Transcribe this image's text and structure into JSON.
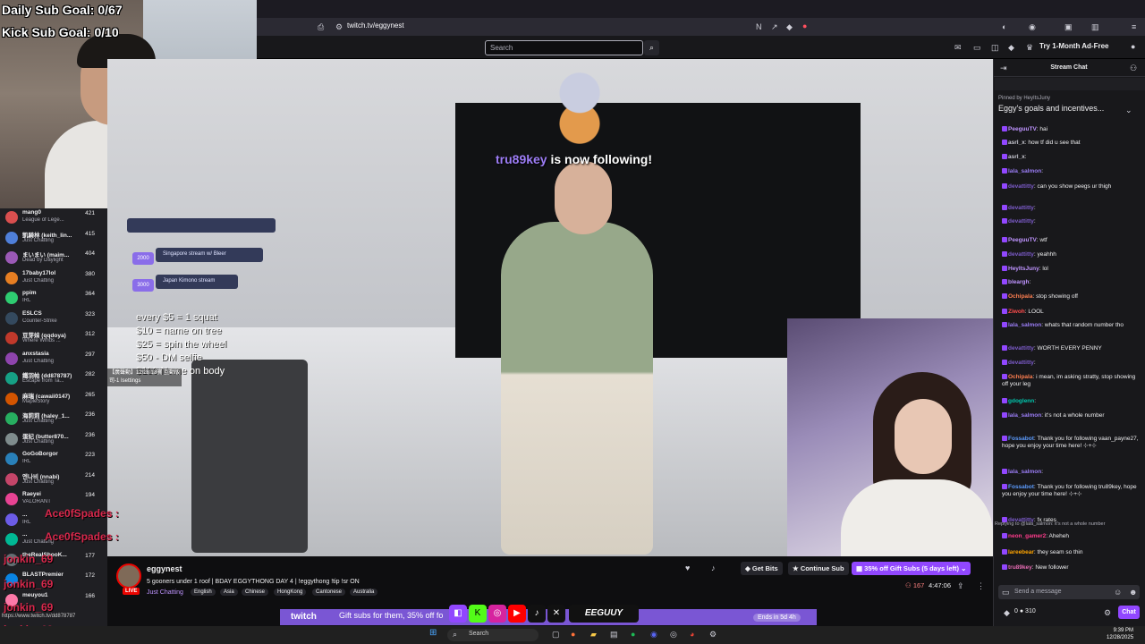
{
  "overlay": {
    "goal1": "Daily Sub Goal: 0/67",
    "goal2": "Kick Sub Goal: 0/10",
    "incentives": [
      "every $5 = 1 squat",
      "$10 = name on tree",
      "$25 = spin the wheel",
      "$50 - DM selfie",
      "$100 Name on body"
    ],
    "pill1_num": "2000",
    "pill1_text": "Singapore stream w/ Bleer",
    "pill2_num": "3000",
    "pill2_text": "Japan Kimono stream",
    "settings_line1": "【廣聲動】12/28 18寶 互動版",
    "settings_line2": "司-1 Isettings",
    "follow_name": "tru89key",
    "follow_text": "is now following!",
    "chat_overlay": [
      "Ace0fSpades :",
      "Ace0fSpades :",
      "jonkin_69",
      "jonkin_69",
      "jonkin_69",
      "jonkin_69"
    ]
  },
  "browser": {
    "url": "twitch.tv/eggynest",
    "search_placeholder": "Search",
    "ad_free": "Try 1-Month Ad-Free"
  },
  "sidebar": {
    "items": [
      {
        "name": "mang0",
        "category": "League of Lege...",
        "count": "421"
      },
      {
        "name": "凱騎林 (keith_lin...",
        "category": "Just Chatting",
        "count": "415"
      },
      {
        "name": "まいまい (maim...",
        "category": "Dead by Daylight",
        "count": "404"
      },
      {
        "name": "17baby17lol",
        "category": "Just Chatting",
        "count": "380"
      },
      {
        "name": "ppim",
        "category": "IRL",
        "count": "364"
      },
      {
        "name": "ESLCS",
        "category": "Counter-Strike",
        "count": "323"
      },
      {
        "name": "豆芽妹 (qqdoya)",
        "category": "Where Winds ...",
        "count": "312"
      },
      {
        "name": "anxstasia",
        "category": "Just Chatting",
        "count": "297"
      },
      {
        "name": "鐵羽帕 (dd878787)",
        "category": "Escape from Ta...",
        "count": "282"
      },
      {
        "name": "麻瑞 (cawaii0147)",
        "category": "MapleStory",
        "count": "265"
      },
      {
        "name": "海莉莉 (haley_1...",
        "category": "Just Chatting",
        "count": "236"
      },
      {
        "name": "蛋妃 (butter870...",
        "category": "Just Chatting",
        "count": "236"
      },
      {
        "name": "GoGoBorgor",
        "category": "IRL",
        "count": "223"
      },
      {
        "name": "엔나비 (nnabi)",
        "category": "Just Chatting",
        "count": "214"
      },
      {
        "name": "Raeyei",
        "category": "VALORANT",
        "count": "194"
      },
      {
        "name": "...",
        "category": "IRL",
        "count": ""
      },
      {
        "name": "...",
        "category": "Just Chatting",
        "count": ""
      },
      {
        "name": "theRealShooK...",
        "category": "",
        "count": "177"
      },
      {
        "name": "BLASTPremier",
        "category": "",
        "count": "172"
      },
      {
        "name": "meuyou1",
        "category": "",
        "count": "166"
      }
    ]
  },
  "stream": {
    "channel": "eggynest",
    "title": "5 gooners under 1 roof | BDAY EGGYTHONG DAY 4 | !eggythong !tip !sr ON",
    "category": "Just Chatting",
    "tags": [
      "English",
      "Asia",
      "Chinese",
      "HongKong",
      "Cantonese",
      "Australia"
    ],
    "live": "LIVE",
    "get_bits": "Get Bits",
    "continue_sub": "Continue Sub",
    "gift_subs": "35% off Gift Subs (5 days left)",
    "viewers": "167",
    "uptime": "4:47:06"
  },
  "banner": {
    "text": "Gift subs for them, 35% off fo",
    "ends": "Ends in 5d 4h",
    "logo": "twitch"
  },
  "chat": {
    "header": "Stream Chat",
    "pinned_by": "Pinned by HeyItsJuny",
    "pinned_text": "Eggy's goals and incentives...",
    "messages": [
      {
        "user": "PeeguuTV",
        "text": "hai",
        "color": "#bf94ff"
      },
      {
        "user": "asrl_x",
        "text": "how tf did u see that",
        "color": "#c7c7cf"
      },
      {
        "user": "asrl_x",
        "text": "",
        "color": "#c7c7cf"
      },
      {
        "user": "lala_salmon",
        "text": "",
        "color": "#9b7df6"
      },
      {
        "user": "devattitty",
        "text": "can you show peegs ur thigh",
        "color": "#7d5ccc"
      },
      {
        "user": "devattitty",
        "text": "",
        "color": "#7d5ccc"
      },
      {
        "user": "devattitty",
        "text": "",
        "color": "#7d5ccc"
      },
      {
        "user": "PeeguuTV",
        "text": "wtf",
        "color": "#bf94ff"
      },
      {
        "user": "devattitty",
        "text": "yeahhh",
        "color": "#7d5ccc"
      },
      {
        "user": "HeyItsJuny",
        "text": "lol",
        "color": "#bf94ff"
      },
      {
        "user": "bleargh",
        "text": "",
        "color": "#bf94ff"
      },
      {
        "user": "Ochipala",
        "text": "stop showing off",
        "color": "#ff7f50"
      },
      {
        "user": "Ziwoh",
        "text": "LOOL",
        "color": "#ff4d4d"
      },
      {
        "user": "lala_salmon",
        "text": "whats that random number tho",
        "color": "#9b7df6"
      },
      {
        "user": "devattitty",
        "text": "WORTH EVERY PENNY",
        "color": "#7d5ccc"
      },
      {
        "user": "devattitty",
        "text": "",
        "color": "#7d5ccc"
      },
      {
        "user": "Ochipala",
        "text": "i mean, im asking stratty, stop showing off your leg",
        "color": "#ff7f50"
      },
      {
        "user": "gdoglenn",
        "text": "",
        "color": "#00c8af"
      },
      {
        "user": "lala_salmon",
        "text": "it's not a whole number",
        "color": "#9b7df6"
      },
      {
        "user": "Fossabot",
        "text": "Thank you for following vaan_payne27, hope you enjoy your time here! ⊹+⊹",
        "color": "#5c9cff"
      },
      {
        "user": "lala_salmon",
        "text": "",
        "color": "#9b7df6"
      },
      {
        "user": "Fossabot",
        "text": "Thank you for following tru89key, hope you enjoy your time here! ⊹+⊹",
        "color": "#5c9cff"
      },
      {
        "user": "devattitty",
        "text": "fx rates",
        "color": "#7d5ccc"
      },
      {
        "user": "neon_gamer2",
        "text": "Aheheh",
        "color": "#ff3c8c"
      },
      {
        "user": "lareebear",
        "text": "they seam so thin",
        "color": "#ffa500"
      },
      {
        "user": "tru89key",
        "text": "New follower",
        "color": "#e66bb3"
      }
    ],
    "reply_note": "Replying to @lala_salmon: it's not a whole number",
    "input_placeholder": "Send a message",
    "points": "310",
    "points_zero": "0",
    "chat_button": "Chat"
  },
  "taskbar": {
    "search": "Search",
    "time": "9:39 PM",
    "date": "12/28/2025"
  },
  "status_url": "https://www.twitch.tv/dd878787"
}
